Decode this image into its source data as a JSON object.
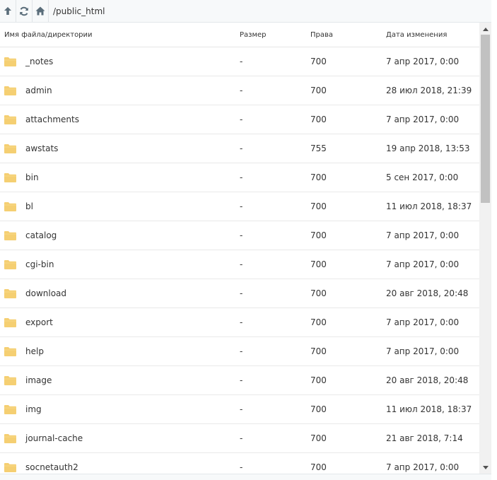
{
  "toolbar": {
    "up_icon": "arrow-up-icon",
    "refresh_icon": "refresh-icon",
    "home_icon": "home-icon",
    "path": "/public_html"
  },
  "columns": {
    "name": "Имя файла/директории",
    "size": "Размер",
    "permissions": "Права",
    "modified": "Дата изменения"
  },
  "colors": {
    "folder": "#f5cf72",
    "icon": "#5a6d7a",
    "scroll_thumb": "#c1c1c1"
  },
  "files": [
    {
      "name": "_notes",
      "size": "-",
      "perm": "700",
      "date": "7 апр 2017, 0:00"
    },
    {
      "name": "admin",
      "size": "-",
      "perm": "700",
      "date": "28 июл 2018, 21:39"
    },
    {
      "name": "attachments",
      "size": "-",
      "perm": "700",
      "date": "7 апр 2017, 0:00"
    },
    {
      "name": "awstats",
      "size": "-",
      "perm": "755",
      "date": "19 апр 2018, 13:53"
    },
    {
      "name": "bin",
      "size": "-",
      "perm": "700",
      "date": "5 сен 2017, 0:00"
    },
    {
      "name": "bl",
      "size": "-",
      "perm": "700",
      "date": "11 июл 2018, 18:37"
    },
    {
      "name": "catalog",
      "size": "-",
      "perm": "700",
      "date": "7 апр 2017, 0:00"
    },
    {
      "name": "cgi-bin",
      "size": "-",
      "perm": "700",
      "date": "7 апр 2017, 0:00"
    },
    {
      "name": "download",
      "size": "-",
      "perm": "700",
      "date": "20 авг 2018, 20:48"
    },
    {
      "name": "export",
      "size": "-",
      "perm": "700",
      "date": "7 апр 2017, 0:00"
    },
    {
      "name": "help",
      "size": "-",
      "perm": "700",
      "date": "7 апр 2017, 0:00"
    },
    {
      "name": "image",
      "size": "-",
      "perm": "700",
      "date": "20 авг 2018, 20:48"
    },
    {
      "name": "img",
      "size": "-",
      "perm": "700",
      "date": "11 июл 2018, 18:37"
    },
    {
      "name": "journal-cache",
      "size": "-",
      "perm": "700",
      "date": "21 авг 2018, 7:14"
    },
    {
      "name": "socnetauth2",
      "size": "-",
      "perm": "700",
      "date": "7 апр 2017, 0:00"
    }
  ]
}
